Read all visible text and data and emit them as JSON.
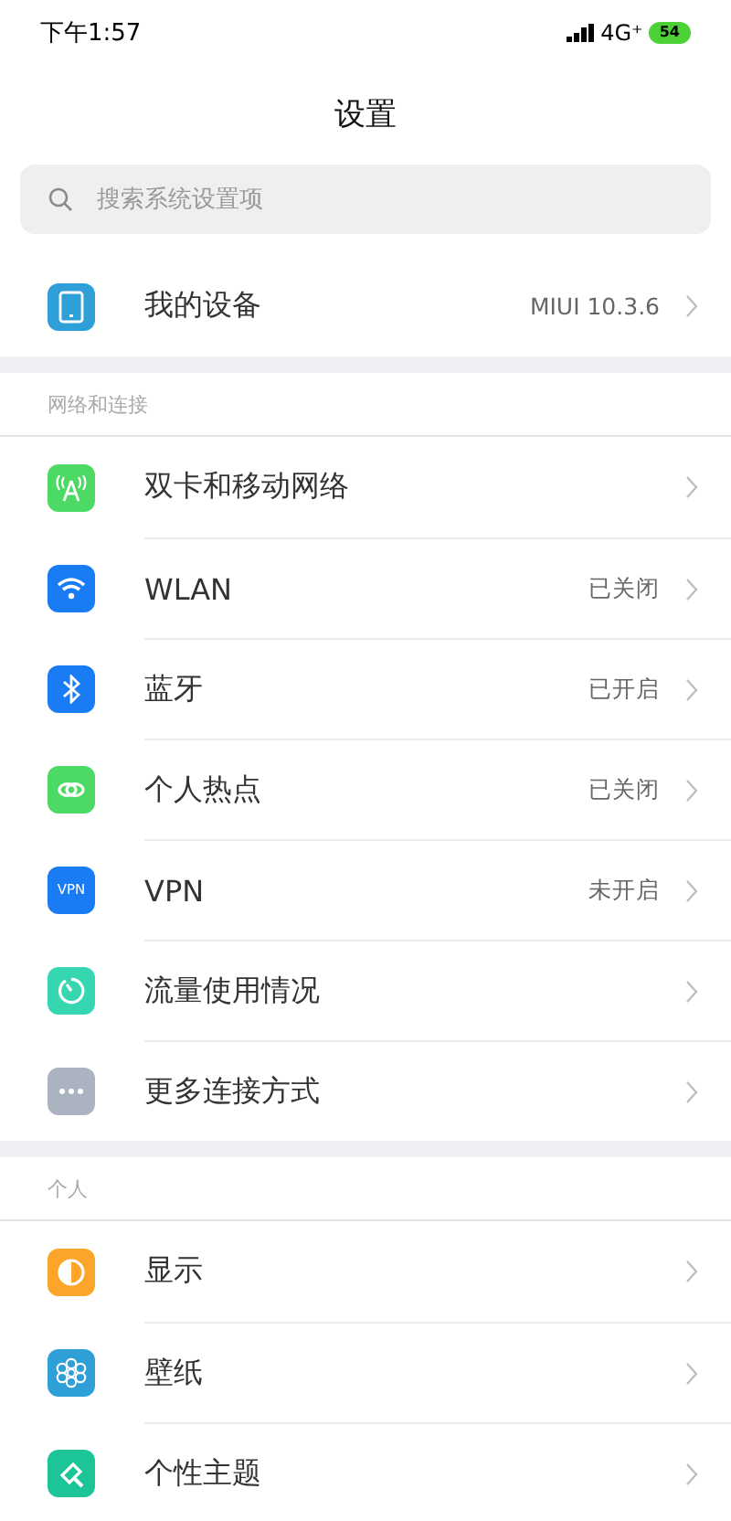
{
  "status_bar": {
    "time": "下午1:57",
    "network": "4G⁺",
    "battery": "54"
  },
  "title": "设置",
  "search": {
    "placeholder": "搜索系统设置项"
  },
  "sections": [
    {
      "items": [
        {
          "kind": "device",
          "label": "我的设备",
          "value": "MIUI 10.3.6"
        }
      ]
    },
    {
      "header": "网络和连接",
      "items": [
        {
          "kind": "antenna",
          "label": "双卡和移动网络"
        },
        {
          "kind": "wifi",
          "label": "WLAN",
          "value": "已关闭"
        },
        {
          "kind": "bluetooth",
          "label": "蓝牙",
          "value": "已开启"
        },
        {
          "kind": "hotspot",
          "label": "个人热点",
          "value": "已关闭"
        },
        {
          "kind": "vpn",
          "icon_text": "VPN",
          "label": "VPN",
          "value": "未开启"
        },
        {
          "kind": "usage",
          "label": "流量使用情况"
        },
        {
          "kind": "more",
          "label": "更多连接方式"
        }
      ]
    },
    {
      "header": "个人",
      "items": [
        {
          "kind": "display",
          "label": "显示"
        },
        {
          "kind": "wallpaper",
          "label": "壁纸"
        },
        {
          "kind": "theme",
          "label": "个性主题"
        }
      ]
    }
  ]
}
